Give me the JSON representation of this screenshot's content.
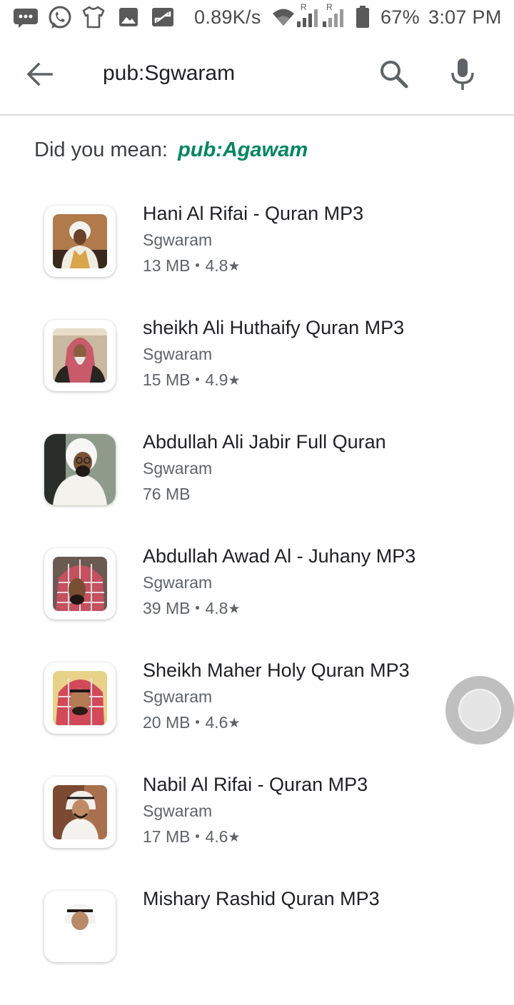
{
  "status_bar": {
    "speed": "0.89K/s",
    "battery": "67%",
    "time": "3:07 PM",
    "signal_1_label": "R",
    "signal_2_label": "R",
    "icons": [
      "message-icon",
      "whatsapp-icon",
      "tshirt-icon",
      "gallery-icon",
      "screenshot-icon",
      "wifi-icon",
      "signal-icon",
      "battery-icon"
    ]
  },
  "search": {
    "query": "pub:Sgwaram"
  },
  "did_you_mean": {
    "label": "Did you mean:",
    "suggestion": "pub:Agawam"
  },
  "apps": [
    {
      "title": "Hani Al Rifai - Quran MP3",
      "developer": "Sgwaram",
      "size": "13 MB",
      "rating": "4.8"
    },
    {
      "title": "sheikh Ali Huthaify Quran MP3",
      "developer": "Sgwaram",
      "size": "15 MB",
      "rating": "4.9"
    },
    {
      "title": "Abdullah Ali Jabir Full Quran",
      "developer": "Sgwaram",
      "size": "76 MB",
      "rating": ""
    },
    {
      "title": "Abdullah Awad Al - Juhany MP3",
      "developer": "Sgwaram",
      "size": "39 MB",
      "rating": "4.8"
    },
    {
      "title": "Sheikh Maher Holy Quran MP3",
      "developer": "Sgwaram",
      "size": "20 MB",
      "rating": "4.6"
    },
    {
      "title": "Nabil Al Rifai - Quran MP3",
      "developer": "Sgwaram",
      "size": "17 MB",
      "rating": "4.6"
    },
    {
      "title": "Mishary Rashid Quran MP3",
      "developer": "",
      "size": "",
      "rating": ""
    }
  ],
  "colors": {
    "suggestion": "#01875f",
    "primary_text": "#202124",
    "secondary_text": "#5f6368"
  }
}
